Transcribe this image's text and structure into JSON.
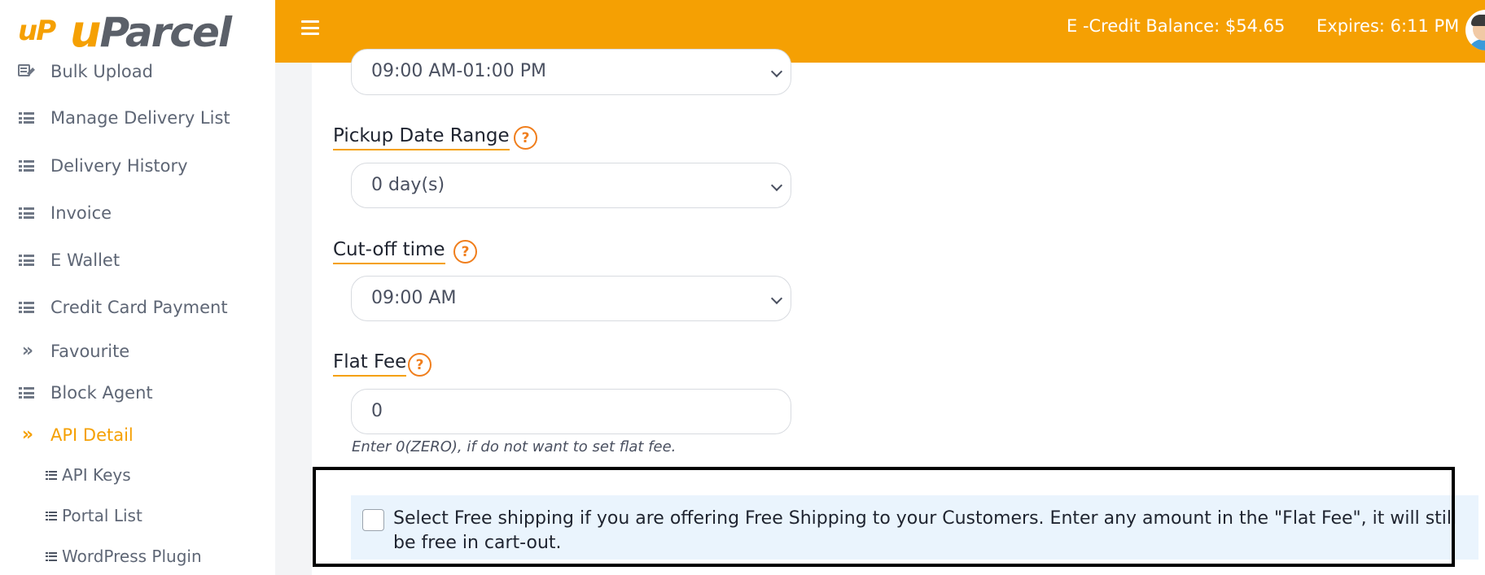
{
  "brand": {
    "mark": "uP",
    "first": "u",
    "rest": "Parcel"
  },
  "sidebar": {
    "items": [
      {
        "label": "Bulk Upload",
        "icon": "edit-list-icon"
      },
      {
        "label": "Manage Delivery List",
        "icon": "list-icon"
      },
      {
        "label": "Delivery History",
        "icon": "list-icon"
      },
      {
        "label": "Invoice",
        "icon": "list-icon"
      },
      {
        "label": "E Wallet",
        "icon": "list-icon"
      },
      {
        "label": "Credit Card Payment",
        "icon": "list-icon"
      },
      {
        "label": "Favourite",
        "icon": "double-chevron-icon"
      },
      {
        "label": "Block Agent",
        "icon": "list-icon"
      },
      {
        "label": "API Detail",
        "icon": "double-chevron-icon",
        "active": true
      }
    ],
    "sub_items": [
      {
        "label": "API Keys"
      },
      {
        "label": "Portal List"
      },
      {
        "label": "WordPress Plugin"
      }
    ]
  },
  "header": {
    "balance": "E -Credit Balance: $54.65",
    "expires": "Expires: 6:11 PM"
  },
  "form": {
    "time_slot": {
      "value": "09:00 AM-01:00 PM"
    },
    "pickup_range": {
      "label": "Pickup Date Range",
      "value": "0 day(s)"
    },
    "cutoff": {
      "label": "Cut-off time",
      "value": "09:00 AM"
    },
    "flat_fee": {
      "label": "Flat Fee",
      "value": "0",
      "hint": "Enter 0(ZERO), if do not want to set flat fee."
    },
    "help_glyph": "?",
    "free_shipping": {
      "text": "Select Free shipping if you are offering Free Shipping to your Customers. Enter any amount in the \"Flat Fee\", it will still be free in cart-out.",
      "checked": false
    }
  },
  "colors": {
    "accent": "#f5a003",
    "help": "#f07e1c",
    "notice_bg": "#eaf4fd"
  }
}
